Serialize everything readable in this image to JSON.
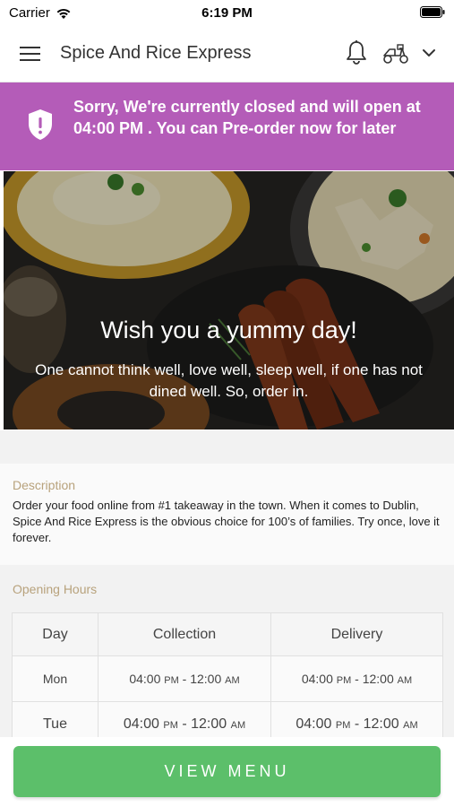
{
  "status_bar": {
    "carrier": "Carrier",
    "time": "6:19 PM",
    "icons": [
      "wifi-icon",
      "battery-icon"
    ]
  },
  "header": {
    "title": "Spice And Rice Express",
    "icons": [
      "menu-icon",
      "bell-icon",
      "scooter-icon",
      "chevron-down-icon"
    ]
  },
  "banner": {
    "text": "Sorry, We're currently closed and will open at 04:00 PM . You can Pre-order now for later",
    "icon": "shield-icon",
    "color": "#b45cb8"
  },
  "hero": {
    "heading": "Wish you a yummy day!",
    "subtext": "One cannot think well, love well, sleep well, if one has not dined well. So, order in."
  },
  "description": {
    "label": "Description",
    "text": "Order your food online from #1 takeaway in the town. When it comes to Dublin, Spice And Rice Express is the obvious choice for 100’s of families. Try once, love it forever."
  },
  "opening_hours": {
    "label": "Opening Hours",
    "headers": [
      "Day",
      "Collection",
      "Delivery"
    ],
    "rows": [
      {
        "day": "Mon",
        "collection_start": "04:00",
        "collection_start_ampm": "PM",
        "collection_end": "12:00",
        "collection_end_ampm": "AM",
        "delivery_start": "04:00",
        "delivery_start_ampm": "PM",
        "delivery_end": "12:00",
        "delivery_end_ampm": "AM"
      },
      {
        "day": "Tue",
        "collection_start": "04:00",
        "collection_start_ampm": "PM",
        "collection_end": "12:00",
        "collection_end_ampm": "AM",
        "delivery_start": "04:00",
        "delivery_start_ampm": "PM",
        "delivery_end": "12:00",
        "delivery_end_ampm": "AM"
      }
    ]
  },
  "footer": {
    "button_label": "VIEW MENU",
    "button_color": "#5cbf6a"
  }
}
